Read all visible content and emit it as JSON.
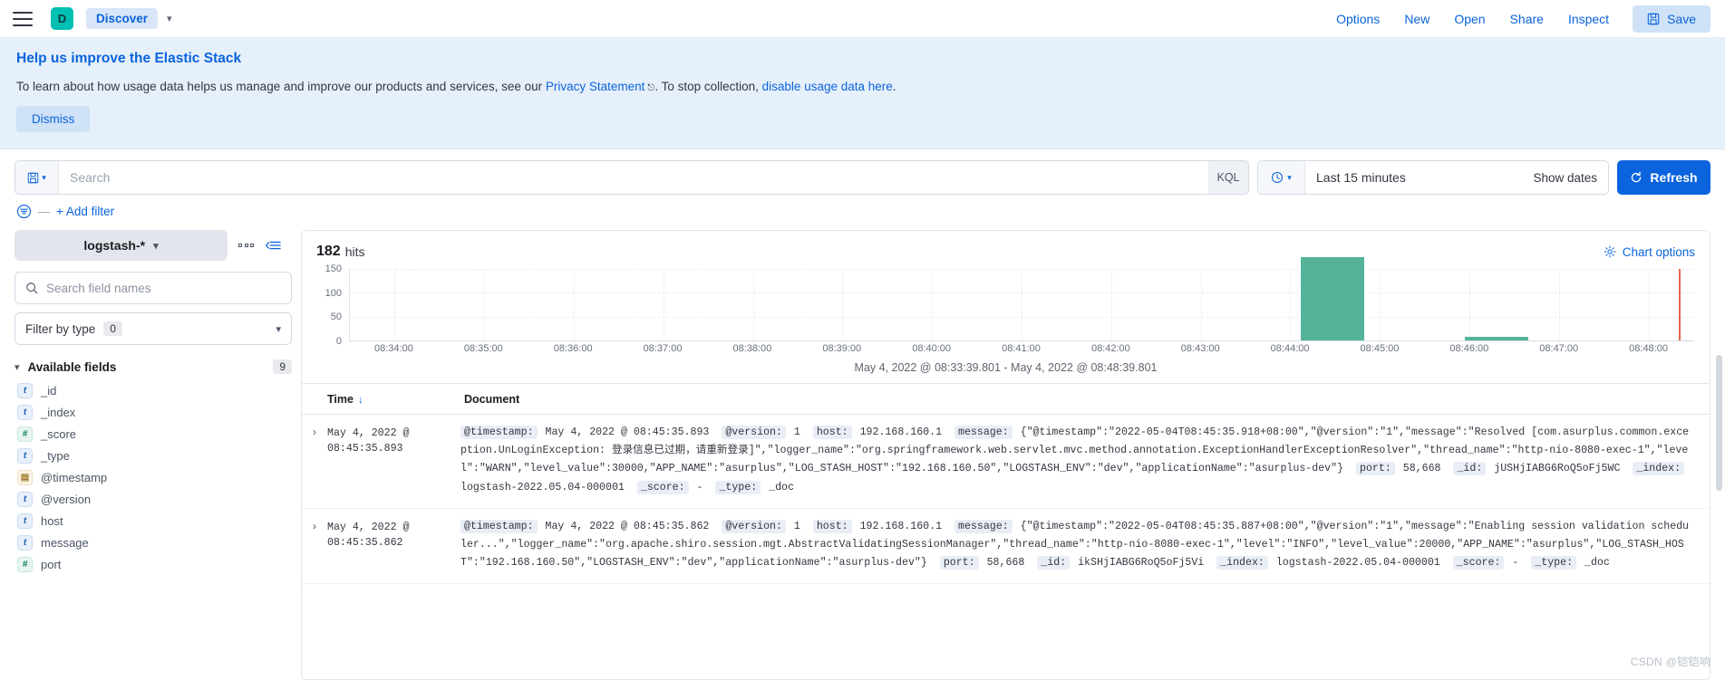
{
  "chrome": {
    "menu_icon": "hamburger-icon",
    "app_badge": "D",
    "breadcrumb": "Discover",
    "nav": [
      "Options",
      "New",
      "Open",
      "Share",
      "Inspect"
    ],
    "save_label": "Save",
    "accent": "#0b64dd",
    "badge_color": "#00BFB3"
  },
  "banner": {
    "title": "Help us improve the Elastic Stack",
    "text_before": "To learn about how usage data helps us manage and improve our products and services, see our ",
    "link1": "Privacy Statement",
    "text_mid": ". To stop collection, ",
    "link2": "disable usage data here",
    "text_after": ".",
    "dismiss_label": "Dismiss",
    "background": "#e6f0fa"
  },
  "query": {
    "search_placeholder": "Search",
    "kql_label": "KQL",
    "date_value": "Last 15 minutes",
    "show_dates_label": "Show dates",
    "refresh_label": "Refresh",
    "add_filter_label": "+ Add filter"
  },
  "sidebar": {
    "index_pattern": "logstash-*",
    "field_search_placeholder": "Search field names",
    "filter_by_type_label": "Filter by type",
    "filter_by_type_count": "0",
    "available_fields_label": "Available fields",
    "available_fields_count": "9",
    "fields": [
      {
        "name": "_id",
        "type": "t"
      },
      {
        "name": "_index",
        "type": "t"
      },
      {
        "name": "_score",
        "type": "#"
      },
      {
        "name": "_type",
        "type": "t"
      },
      {
        "name": "@timestamp",
        "type": "date"
      },
      {
        "name": "@version",
        "type": "t"
      },
      {
        "name": "host",
        "type": "t"
      },
      {
        "name": "message",
        "type": "t"
      },
      {
        "name": "port",
        "type": "#"
      }
    ]
  },
  "main": {
    "hits_count": "182",
    "hits_label": "hits",
    "chart_options_label": "Chart options",
    "time_range_caption": "May 4, 2022 @ 08:33:39.801 - May 4, 2022 @ 08:48:39.801",
    "col_time": "Time",
    "col_document": "Document",
    "sort_arrow": "↓"
  },
  "chart_data": {
    "type": "bar",
    "title": "",
    "xlabel": "",
    "ylabel": "",
    "ylim": [
      0,
      150
    ],
    "yticks": [
      0,
      50,
      100,
      150
    ],
    "grid": true,
    "bar_color": "#54b399",
    "marker_color": "#e7664c",
    "categories": [
      "08:34:00",
      "08:35:00",
      "08:36:00",
      "08:37:00",
      "08:38:00",
      "08:39:00",
      "08:40:00",
      "08:41:00",
      "08:42:00",
      "08:43:00",
      "08:44:00",
      "08:45:00",
      "08:46:00",
      "08:47:00",
      "08:48:00"
    ],
    "xticks": [
      "08:34:00",
      "08:35:00",
      "08:36:00",
      "08:37:00",
      "08:38:00",
      "08:39:00",
      "08:40:00",
      "08:41:00",
      "08:42:00",
      "08:43:00",
      "08:44:00",
      "08:45:00",
      "08:46:00",
      "08:47:00",
      "08:48:00"
    ],
    "bars": [
      {
        "x": "08:44:30",
        "value": 174,
        "x_pct": 70.8,
        "width_pct": 4.7
      },
      {
        "x": "08:45:30",
        "value": 8,
        "x_pct": 83.0,
        "width_pct": 4.7
      }
    ],
    "marker": {
      "x": "08:48:39",
      "x_pct": 98.9
    }
  },
  "documents": [
    {
      "time": "May 4, 2022 @ 08:45:35.893",
      "fields": [
        {
          "key": "@timestamp:",
          "value": "May 4, 2022 @ 08:45:35.893"
        },
        {
          "key": "@version:",
          "value": "1"
        },
        {
          "key": "host:",
          "value": "192.168.160.1"
        },
        {
          "key": "message:",
          "value": "{\"@timestamp\":\"2022-05-04T08:45:35.918+08:00\",\"@version\":\"1\",\"message\":\"Resolved [com.asurplus.common.exception.UnLoginException: 登录信息已过期，请重新登录]\",\"logger_name\":\"org.springframework.web.servlet.mvc.method.annotation.ExceptionHandlerExceptionResolver\",\"thread_name\":\"http-nio-8080-exec-1\",\"level\":\"WARN\",\"level_value\":30000,\"APP_NAME\":\"asurplus\",\"LOG_STASH_HOST\":\"192.168.160.50\",\"LOGSTASH_ENV\":\"dev\",\"applicationName\":\"asurplus-dev\"}"
        },
        {
          "key": "port:",
          "value": "58,668"
        },
        {
          "key": "_id:",
          "value": "jUSHjIABG6RoQ5oFj5WC"
        },
        {
          "key": "_index:",
          "value": "logstash-2022.05.04-000001"
        },
        {
          "key": "_score:",
          "value": "-"
        },
        {
          "key": "_type:",
          "value": "_doc"
        }
      ]
    },
    {
      "time": "May 4, 2022 @ 08:45:35.862",
      "fields": [
        {
          "key": "@timestamp:",
          "value": "May 4, 2022 @ 08:45:35.862"
        },
        {
          "key": "@version:",
          "value": "1"
        },
        {
          "key": "host:",
          "value": "192.168.160.1"
        },
        {
          "key": "message:",
          "value": "{\"@timestamp\":\"2022-05-04T08:45:35.887+08:00\",\"@version\":\"1\",\"message\":\"Enabling session validation scheduler...\",\"logger_name\":\"org.apache.shiro.session.mgt.AbstractValidatingSessionManager\",\"thread_name\":\"http-nio-8080-exec-1\",\"level\":\"INFO\",\"level_value\":20000,\"APP_NAME\":\"asurplus\",\"LOG_STASH_HOST\":\"192.168.160.50\",\"LOGSTASH_ENV\":\"dev\",\"applicationName\":\"asurplus-dev\"}"
        },
        {
          "key": "port:",
          "value": "58,668"
        },
        {
          "key": "_id:",
          "value": "ikSHjIABG6RoQ5oFj5Vi"
        },
        {
          "key": "_index:",
          "value": "logstash-2022.05.04-000001"
        },
        {
          "key": "_score:",
          "value": "-"
        },
        {
          "key": "_type:",
          "value": "_doc"
        }
      ]
    }
  ],
  "watermark": "CSDN @铠铠响"
}
